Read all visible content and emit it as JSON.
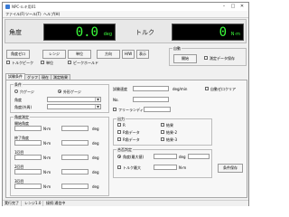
{
  "window": {
    "title": "NPC-ルキ用01"
  },
  "titlebar_controls": {
    "minimize": "–",
    "maximize": "□",
    "close": "✕"
  },
  "menu": [
    "ファイル(F)",
    "ツール(T)",
    "ヘルプ(H)"
  ],
  "readouts": {
    "angle": {
      "label": "角度",
      "value": "0.0",
      "unit": "deg"
    },
    "torque": {
      "label": "トルク",
      "value": "0",
      "unit": "N·m"
    }
  },
  "toolbar": {
    "buttons": [
      "角度ゼロ",
      "レンジ",
      "単位",
      "方向",
      "H/W",
      "表示"
    ],
    "checks": [
      {
        "label": "トルクピーク",
        "checked": false
      },
      {
        "label": "単位",
        "checked": false
      },
      {
        "label": "ピークホールド",
        "checked": false
      }
    ]
  },
  "record": {
    "title": "自動",
    "button": "開始",
    "checkbox": "測定データ保存"
  },
  "tabs": [
    "試験条件",
    "グラフ",
    "現在",
    "測定結果"
  ],
  "conditions": {
    "title": "条件",
    "radio_left": "穴ゲージ",
    "radio_right": "外形ゲージ",
    "row1_label": "角度",
    "row2_label": "角度(外周)"
  },
  "measure": {
    "title": "角度測定",
    "rows": [
      {
        "label": "開始角度",
        "unit": "deg"
      },
      {
        "label": "終了角度",
        "unit": "deg"
      },
      {
        "label": "1回目",
        "unit": "deg"
      },
      {
        "label": "2回目",
        "unit": "deg"
      },
      {
        "label": "3回目",
        "unit": "deg"
      }
    ],
    "mid_unit": "N·m"
  },
  "right_top": {
    "speed_label": "試験速度",
    "speed_unit": "deg/min",
    "nc_label": "No.",
    "auto_check": "自動ゼロクリア",
    "free_check": "フリーランディング"
  },
  "output": {
    "title": "出力",
    "items": [
      "R",
      "R角データ",
      "R角データ",
      "結果",
      "結果-2",
      "結果-3"
    ]
  },
  "judge": {
    "title": "合否判定",
    "radio1": "角度(最大値)",
    "unit1": "deg",
    "check2": "トルク最大",
    "unit2": "N·m",
    "save_button": "条件保存"
  },
  "status": [
    "実行完了",
    "レンジ1.0",
    "接続:通信中"
  ],
  "colors": {
    "lcd_bg": "#000000",
    "lcd_text": "#3cff3c"
  }
}
